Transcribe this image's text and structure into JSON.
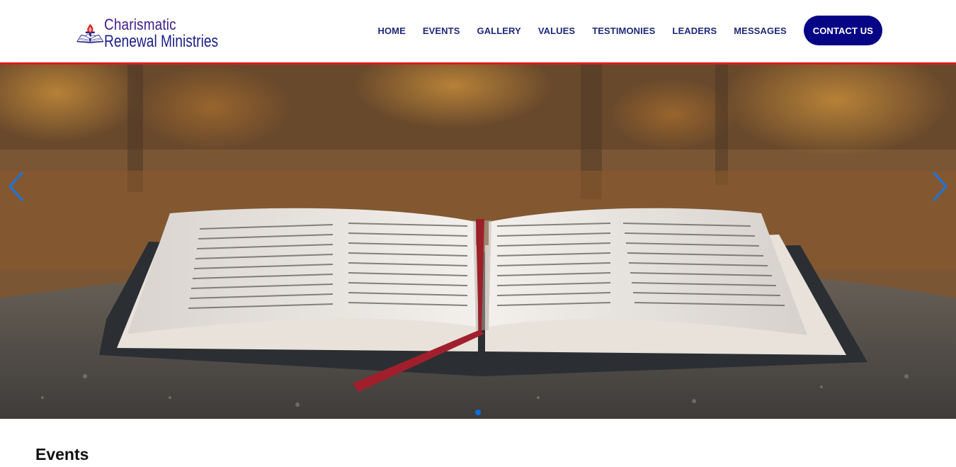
{
  "brand": {
    "line1": "Charismatic",
    "line2": "Renewal Ministries"
  },
  "nav": {
    "items": [
      {
        "label": "HOME"
      },
      {
        "label": "EVENTS"
      },
      {
        "label": "GALLERY"
      },
      {
        "label": "VALUES"
      },
      {
        "label": "TESTIMONIES"
      },
      {
        "label": "LEADERS"
      },
      {
        "label": "MESSAGES"
      }
    ],
    "contact_label": "CONTACT US"
  },
  "slider": {
    "prev_icon": "chevron-left-icon",
    "next_icon": "chevron-right-icon",
    "slide_count": 1,
    "active_index": 0
  },
  "colors": {
    "nav_text": "#1f2a7a",
    "contact_bg": "#050585",
    "header_border": "#e21b1b",
    "slider_accent": "#0b6fe0"
  },
  "events": {
    "title": "Events"
  }
}
